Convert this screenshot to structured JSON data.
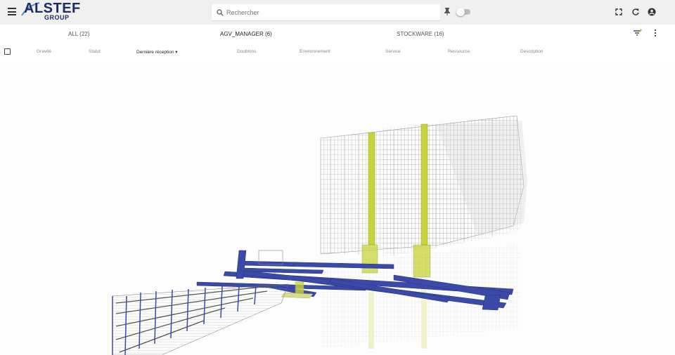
{
  "app": {
    "logo_text": "ALSTEF",
    "logo_sub": "GROUP"
  },
  "search": {
    "placeholder": "Rechercher"
  },
  "toolbar": {
    "icons": [
      "menu-icon",
      "search-icon",
      "pin-icon",
      "fullscreen-icon",
      "refresh-icon",
      "account-icon"
    ],
    "toggle_on": false
  },
  "tabs": [
    {
      "label": "ALL (22)"
    },
    {
      "label": "AGV_MANAGER (6)"
    },
    {
      "label": "STOCKWARE (16)"
    }
  ],
  "columns": {
    "gravite": "Gravité",
    "statut": "Statut",
    "derniere_reception": "Dernière réception",
    "doublons": "Doublons",
    "environnement": "Environnement",
    "service": "Service",
    "ressource": "Ressource",
    "description": "Description",
    "sort_indicator": "▾"
  },
  "colors": {
    "brand": "#1c2c5c",
    "rack_yellow": "#c8d43a",
    "conveyor_blue": "#3b4aa8"
  }
}
